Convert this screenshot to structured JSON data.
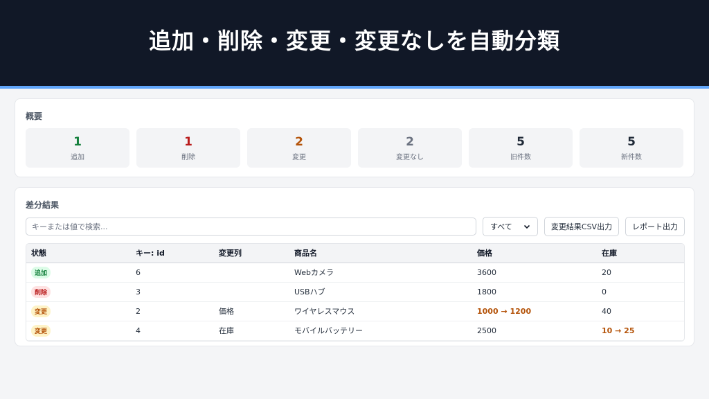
{
  "banner": {
    "title": "追加・削除・変更・変更なしを自動分類"
  },
  "colors": {
    "added": "#15803d",
    "deleted": "#b91c1c",
    "changed": "#b45309",
    "unchanged": "#6b7280",
    "accent": "#60a5fa"
  },
  "summary": {
    "title": "概要",
    "stats": [
      {
        "value": "1",
        "label": "追加"
      },
      {
        "value": "1",
        "label": "削除"
      },
      {
        "value": "2",
        "label": "変更"
      },
      {
        "value": "2",
        "label": "変更なし"
      },
      {
        "value": "5",
        "label": "旧件数"
      },
      {
        "value": "5",
        "label": "新件数"
      }
    ]
  },
  "results": {
    "title": "差分結果",
    "search_placeholder": "キーまたは値で検索...",
    "filter_value": "すべて",
    "csv_button": "変更結果CSV出力",
    "report_button": "レポート出力",
    "columns": [
      "状態",
      "キー: id",
      "変更列",
      "商品名",
      "価格",
      "在庫"
    ],
    "rows": [
      {
        "status": "追加",
        "id": "6",
        "changed_col": "",
        "name": "Webカメラ",
        "price": "3600",
        "stock": "20"
      },
      {
        "status": "削除",
        "id": "3",
        "changed_col": "",
        "name": "USBハブ",
        "price": "1800",
        "stock": "0"
      },
      {
        "status": "変更",
        "id": "2",
        "changed_col": "価格",
        "name": "ワイヤレスマウス",
        "price": "1000 → 1200",
        "stock": "40"
      },
      {
        "status": "変更",
        "id": "4",
        "changed_col": "在庫",
        "name": "モバイルバッテリー",
        "price": "2500",
        "stock": "10 → 25"
      }
    ]
  }
}
